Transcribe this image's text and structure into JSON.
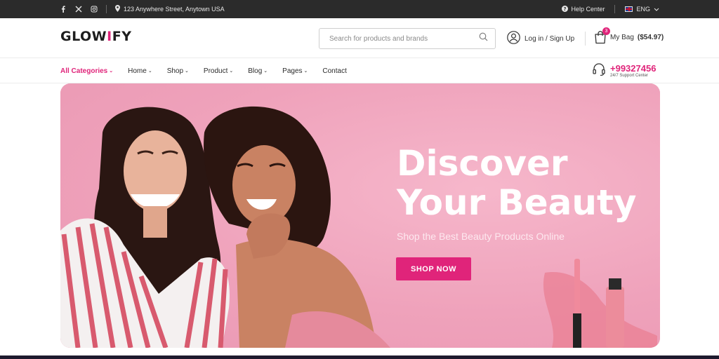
{
  "topbar": {
    "social_icons": [
      "facebook-icon",
      "x-icon",
      "instagram-icon"
    ],
    "address": "123 Anywhere Street, Anytown USA",
    "help_label": "Help Center",
    "language": "ENG"
  },
  "header": {
    "logo_text": "GLOW",
    "logo_accent": "I",
    "logo_tail": "FY",
    "search_placeholder": "Search for products and brands",
    "login_label": "Log in / Sign Up",
    "bag_label": "My Bag",
    "bag_total": "($54.97)",
    "bag_count": "3"
  },
  "nav": {
    "items": [
      {
        "label": "All Categories",
        "dropdown": true
      },
      {
        "label": "Home",
        "dropdown": true
      },
      {
        "label": "Shop",
        "dropdown": true
      },
      {
        "label": "Product",
        "dropdown": true
      },
      {
        "label": "Blog",
        "dropdown": true
      },
      {
        "label": "Pages",
        "dropdown": true
      },
      {
        "label": "Contact",
        "dropdown": false
      }
    ],
    "phone": "+99327456",
    "support_label": "24/7 Support Center"
  },
  "hero": {
    "title_line1": "Discover",
    "title_line2": "Your Beauty",
    "subtitle": "Shop the Best Beauty Products Online",
    "cta_label": "SHOP NOW"
  },
  "colors": {
    "accent": "#e0247a",
    "topbar_bg": "#2b2b2b",
    "hero_bg": "#f0a7bf"
  }
}
